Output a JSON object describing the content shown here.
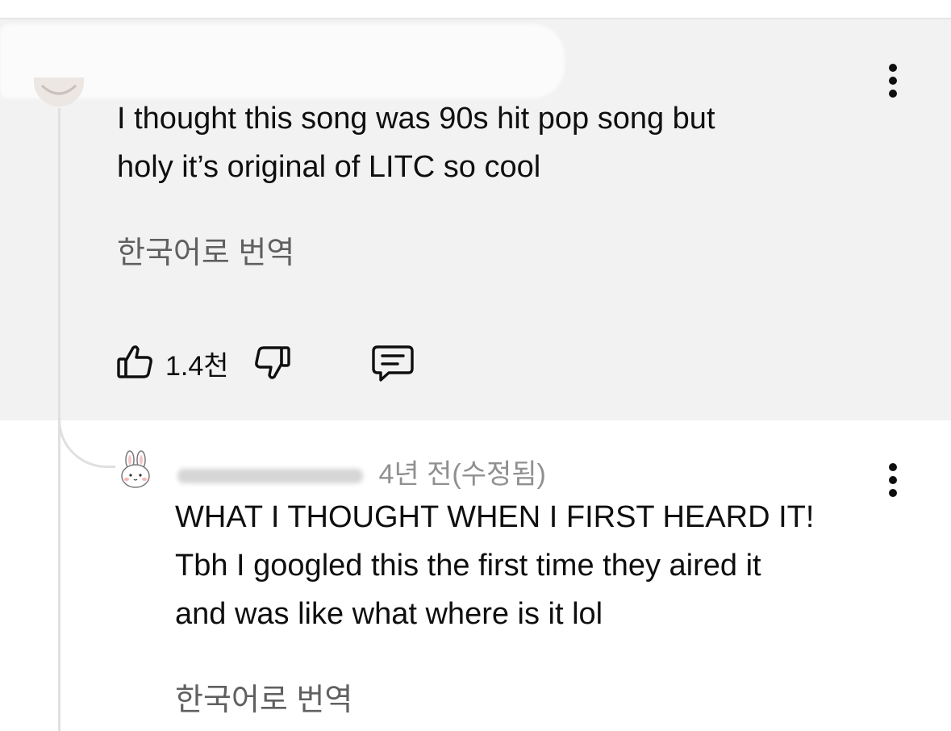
{
  "comment": {
    "text": "I thought this song was 90s hit pop song but\nholy it’s original of LITC so cool",
    "translate_label": "한국어로 번역",
    "like_count": "1.4천",
    "icons": {
      "like": "thumbs-up-icon",
      "dislike": "thumbs-down-icon",
      "reply": "comment-reply-icon",
      "more": "more-vert-icon"
    }
  },
  "reply": {
    "timestamp": "4년 전(수정됨)",
    "text": "WHAT I THOUGHT WHEN I FIRST HEARD IT!\nTbh I googled this the first time they aired it\nand was like what where is it lol",
    "translate_label": "한국어로 번역",
    "icons": {
      "avatar": "bunny-avatar-icon",
      "more": "more-vert-icon"
    }
  },
  "colors": {
    "highlight_background": "#f2f2f2",
    "primary_text": "#0f0f0f",
    "secondary_text": "#606060",
    "thread_line": "#e0e0e0"
  }
}
